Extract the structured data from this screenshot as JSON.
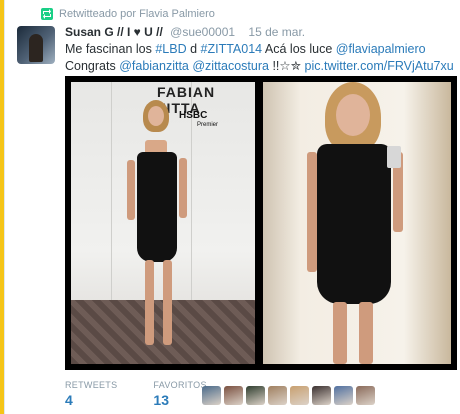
{
  "retweet": {
    "label": "Retwitteado por Flavia Palmiero"
  },
  "tweet": {
    "name": "Susan G // I ♥ U //",
    "handle": "@sue00001",
    "time": "15 de mar.",
    "text": {
      "part1": "Me fascinan los ",
      "hashtag1": "#LBD",
      "part2": " d ",
      "hashtag2": "#ZITTA014",
      "part3": " Acá los luce ",
      "mention1": "@flaviapalmiero",
      "part4": "  Congrats ",
      "mention2": "@fabianzitta",
      "part5": " ",
      "mention3": "@zittacostura",
      "part6": " !!☆✮ ",
      "link": "pic.twitter.com/FRVjAtu7xu"
    }
  },
  "media": {
    "photo1_banner": "FABIAN ZITTA",
    "photo1_hsbc": "HSBC",
    "photo1_premier": "Premier"
  },
  "stats": {
    "retweets_label": "RETWEETS",
    "retweets_value": "4",
    "favorites_label": "FAVORITOS",
    "favorites_value": "13"
  },
  "favoriters": [
    {
      "icon": "avatar-icon",
      "color": "#4a6a8a"
    },
    {
      "icon": "avatar-icon",
      "color": "#7a5040"
    },
    {
      "icon": "avatar-icon",
      "color": "#2f3e2f"
    },
    {
      "icon": "avatar-icon",
      "color": "#a08060"
    },
    {
      "icon": "avatar-icon",
      "color": "#c8a070"
    },
    {
      "icon": "avatar-icon",
      "color": "#3a3030"
    },
    {
      "icon": "avatar-icon",
      "color": "#5070a0"
    },
    {
      "icon": "avatar-icon",
      "color": "#8a6a5a"
    }
  ],
  "colors": {
    "accent": "#f5c518",
    "link": "#2b7bb9",
    "retweet": "#19cf86"
  }
}
